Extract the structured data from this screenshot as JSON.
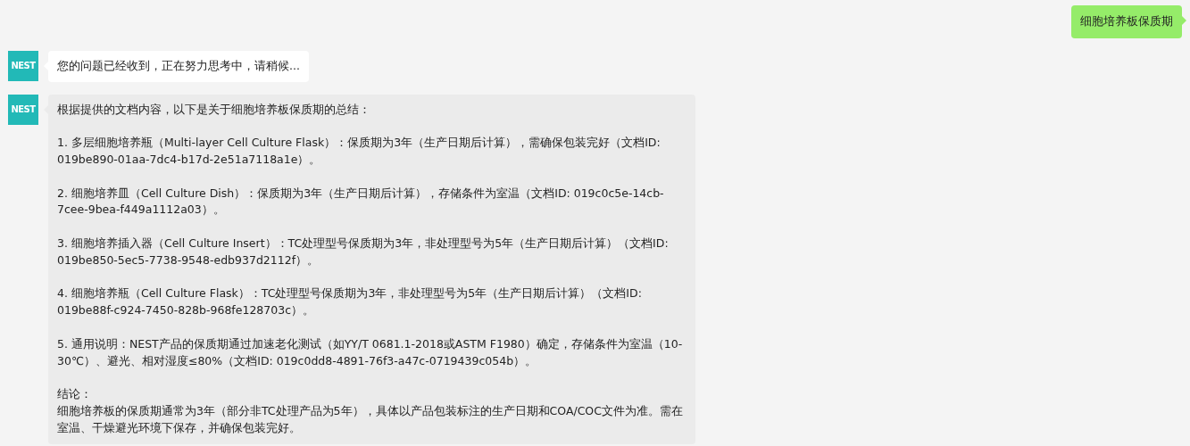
{
  "messages": [
    {
      "kind": "question",
      "blocks": [
        [
          "细胞培养板保质期"
        ]
      ]
    },
    {
      "kind": "status",
      "avatar": "NEST",
      "blocks": [
        [
          "您的问题已经收到，正在努力思考中，请稍候..."
        ]
      ]
    },
    {
      "kind": "answer",
      "avatar": "NEST",
      "blocks": [
        [
          "根据提供的文档内容，以下是关于细胞培养板保质期的总结："
        ],
        [
          "1. 多层细胞培养瓶（Multi-layer Cell Culture Flask）：保质期为3年（生产日期后计算），需确保包装完好（文档ID: 019be890-01aa-7dc4-b17d-2e51a7118a1e）。"
        ],
        [
          "2. 细胞培养皿（Cell Culture Dish）：保质期为3年（生产日期后计算），存储条件为室温（文档ID: 019c0c5e-14cb-7cee-9bea-f449a1112a03）。"
        ],
        [
          "3. 细胞培养插入器（Cell Culture Insert）：TC处理型号保质期为3年，非处理型号为5年（生产日期后计算）（文档ID: 019be850-5ec5-7738-9548-edb937d2112f）。"
        ],
        [
          "4. 细胞培养瓶（Cell Culture Flask）：TC处理型号保质期为3年，非处理型号为5年（生产日期后计算）（文档ID: 019be88f-c924-7450-828b-968fe128703c）。"
        ],
        [
          "5. 通用说明：NEST产品的保质期通过加速老化测试（如YY/T 0681.1-2018或ASTM F1980）确定，存储条件为室温（10-30℃）、避光、相对湿度≤80%（文档ID: 019c0dd8-4891-76f3-a47c-0719439c054b）。"
        ],
        [
          "结论：",
          "细胞培养板的保质期通常为3年（部分非TC处理产品为5年），具体以产品包装标注的生产日期和COA/COC文件为准。需在室温、干燥避光环境下保存，并确保包装完好。"
        ]
      ]
    }
  ]
}
